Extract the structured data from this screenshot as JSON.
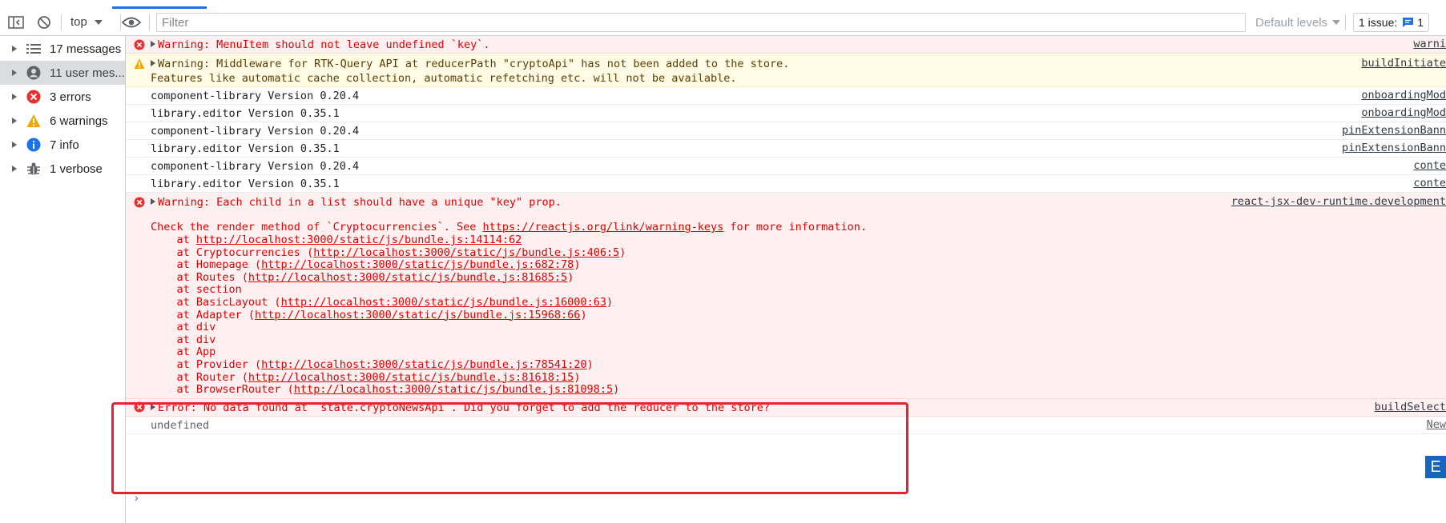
{
  "toolbar": {
    "context": "top",
    "filter_placeholder": "Filter",
    "levels_label": "Default levels",
    "issues_label": "1 issue:",
    "issues_count": "1"
  },
  "sidebar": {
    "items": [
      {
        "label": "17 messages",
        "icon": "list-icon"
      },
      {
        "label": "11 user mes...",
        "icon": "user-icon"
      },
      {
        "label": "3 errors",
        "icon": "error-icon"
      },
      {
        "label": "6 warnings",
        "icon": "warning-icon"
      },
      {
        "label": "7 info",
        "icon": "info-icon"
      },
      {
        "label": "1 verbose",
        "icon": "bug-icon"
      }
    ]
  },
  "console": {
    "r1": {
      "text": "Warning: MenuItem should not leave undefined `key`.",
      "src": "warni"
    },
    "r2": {
      "line1": "Warning: Middleware for RTK-Query API at reducerPath \"cryptoApi\" has not been added to the store.",
      "line2": "Features like automatic cache collection, automatic refetching etc. will not be available.",
      "src": "buildInitiate"
    },
    "r3": {
      "text": "component-library Version 0.20.4",
      "src": "onboardingMod"
    },
    "r4": {
      "text": "library.editor Version 0.35.1",
      "src": "onboardingMod"
    },
    "r5": {
      "text": "component-library Version 0.20.4",
      "src": "pinExtensionBann"
    },
    "r6": {
      "text": "library.editor Version 0.35.1",
      "src": "pinExtensionBann"
    },
    "r7": {
      "text": "component-library Version 0.20.4",
      "src": "conte"
    },
    "r8": {
      "text": "library.editor Version 0.35.1",
      "src": "conte"
    },
    "r9": {
      "head": "Warning: Each child in a list should have a unique \"key\" prop.",
      "src": "react-jsx-dev-runtime.development",
      "check_pre": "Check the render method of `Cryptocurrencies`. See ",
      "check_link": "https://reactjs.org/link/warning-keys",
      "check_post": " for more information.",
      "stack": [
        {
          "pre": "    at ",
          "link": "http://localhost:3000/static/js/bundle.js:14114:62",
          "post": ""
        },
        {
          "pre": "    at Cryptocurrencies (",
          "link": "http://localhost:3000/static/js/bundle.js:406:5",
          "post": ")"
        },
        {
          "pre": "    at Homepage (",
          "link": "http://localhost:3000/static/js/bundle.js:682:78",
          "post": ")"
        },
        {
          "pre": "    at Routes (",
          "link": "http://localhost:3000/static/js/bundle.js:81685:5",
          "post": ")"
        },
        {
          "pre": "    at section",
          "link": "",
          "post": ""
        },
        {
          "pre": "    at BasicLayout (",
          "link": "http://localhost:3000/static/js/bundle.js:16000:63",
          "post": ")"
        },
        {
          "pre": "    at Adapter (",
          "link": "http://localhost:3000/static/js/bundle.js:15968:66",
          "post": ")"
        },
        {
          "pre": "    at div",
          "link": "",
          "post": ""
        },
        {
          "pre": "    at div",
          "link": "",
          "post": ""
        },
        {
          "pre": "    at App",
          "link": "",
          "post": ""
        },
        {
          "pre": "    at Provider (",
          "link": "http://localhost:3000/static/js/bundle.js:78541:20",
          "post": ")"
        },
        {
          "pre": "    at Router (",
          "link": "http://localhost:3000/static/js/bundle.js:81618:15",
          "post": ")"
        },
        {
          "pre": "    at BrowserRouter (",
          "link": "http://localhost:3000/static/js/bundle.js:81098:5",
          "post": ")"
        }
      ]
    },
    "r10": {
      "text": "Error: No data found at `state.cryptoNewsApi`. Did you forget to add the reducer to the store?",
      "src": "buildSelect"
    },
    "r11": {
      "text": "undefined",
      "src": "New"
    }
  },
  "colors": {
    "error": "#e00000",
    "error_bg": "#fef0f0",
    "warning_bg": "#fffbe5",
    "accent": "#1a73e8",
    "highlight_box": "#e6232a"
  }
}
